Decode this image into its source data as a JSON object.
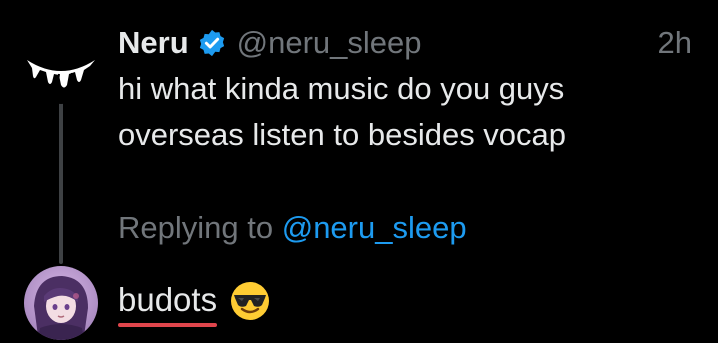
{
  "tweet": {
    "author": {
      "display_name": "Neru",
      "handle": "@neru_sleep",
      "verified": true,
      "avatar_icon": "dripping-teeth-icon"
    },
    "timestamp": "2h",
    "text_lines": [
      "hi what kinda music do you guys",
      "overseas listen to besides vocap"
    ]
  },
  "reply": {
    "replying_to_label": "Replying to",
    "replying_to_handle": "@neru_sleep",
    "draft_text": "budots",
    "emoji": "smiling-face-with-sunglasses",
    "avatar_icon": "anime-avatar-icon"
  },
  "colors": {
    "background": "#000000",
    "primary_text": "#e7e9ea",
    "secondary_text": "#71767b",
    "link_blue": "#1d9bf0",
    "verified_blue": "#1d9bf0",
    "thread_line": "#3e4144",
    "spellcheck_red": "#e0454c"
  }
}
